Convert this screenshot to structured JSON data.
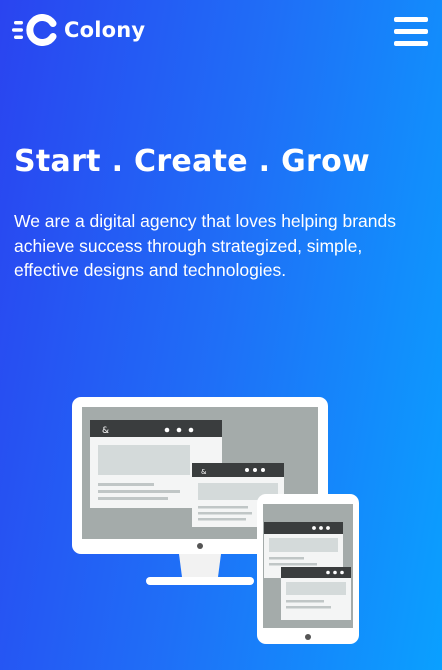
{
  "header": {
    "brand": "Colony",
    "logo_icon": "speed-c-logo-icon",
    "menu_icon": "hamburger-menu-icon"
  },
  "hero": {
    "title": "Start . Create . Grow",
    "description": "We are a digital agency that loves helping brands achieve success through strategized, simple, effective designs and technologies."
  },
  "illustration": {
    "icon": "devices-illustration-icon",
    "window_glyph": "&"
  },
  "colors": {
    "gradient_start": "#2a44f0",
    "gradient_end": "#0aa0ff",
    "text": "#ffffff"
  }
}
